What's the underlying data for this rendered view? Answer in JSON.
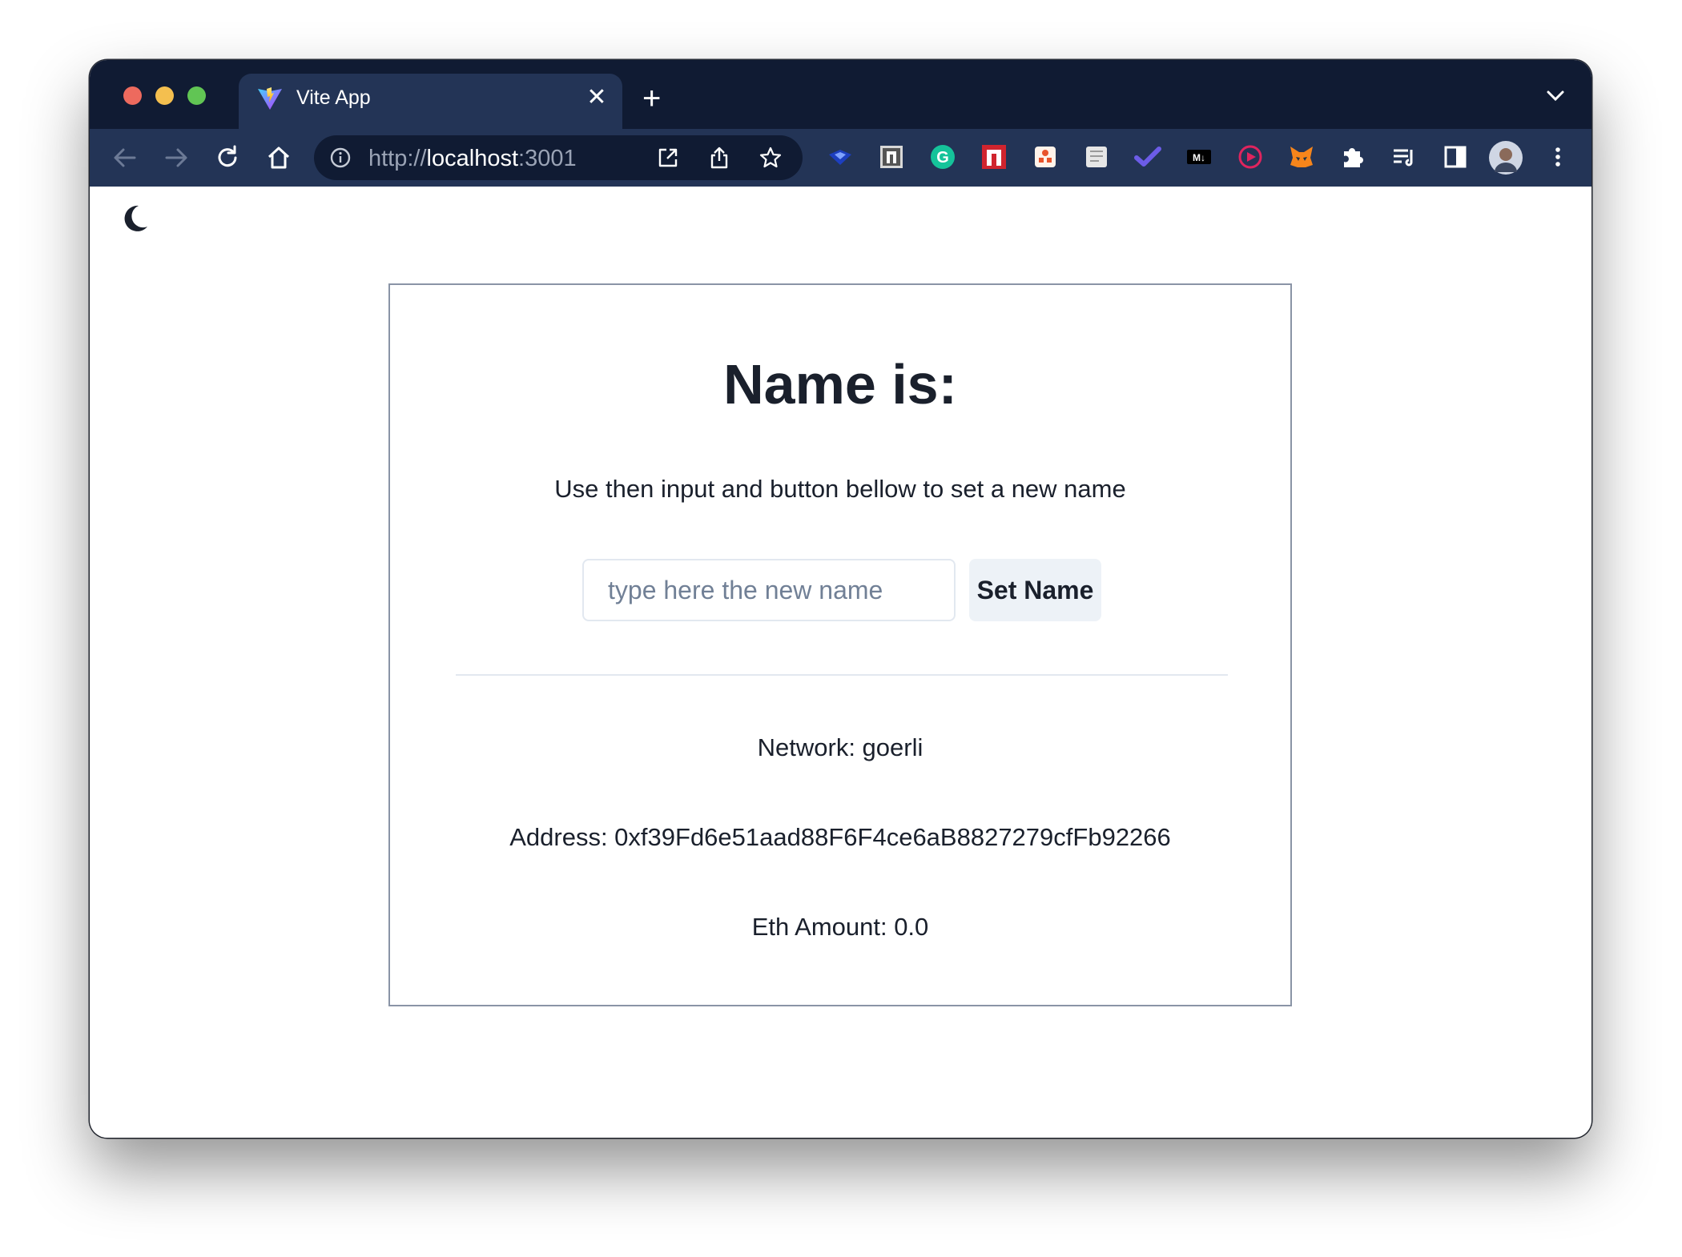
{
  "browser": {
    "tab_title": "Vite App",
    "tab_close": "✕",
    "new_tab": "+",
    "url_scheme": "http://",
    "url_host": "localhost",
    "url_port": ":3001"
  },
  "extensions": [
    "bird-extension-icon",
    "notion-extension-icon",
    "grammarly-extension-icon",
    "red-n-extension-icon",
    "coupon-extension-icon",
    "note-extension-icon",
    "check-extension-icon",
    "markdown-extension-icon",
    "video-extension-icon",
    "metamask-extension-icon",
    "puzzle-extension-icon",
    "reading-list-icon",
    "sidepanel-icon",
    "profile-avatar-icon",
    "menu-icon"
  ],
  "extension_labels": {
    "markdown": "M↓",
    "grammarly": "G"
  },
  "main": {
    "title": "Name is:",
    "subtitle": "Use then input and button bellow to set a new name",
    "input_placeholder": "type here the new name",
    "input_value": "",
    "set_button": "Set Name",
    "network": "Network: goerli",
    "address": "Address: 0xf39Fd6e51aad88F6F4ce6aB8827279cfFb92266",
    "eth_amount": "Eth Amount: 0.0"
  },
  "colors": {
    "tabbar": "#101b33",
    "toolbar": "#233456",
    "text": "#1a202c",
    "button_bg": "#edf2f7"
  }
}
